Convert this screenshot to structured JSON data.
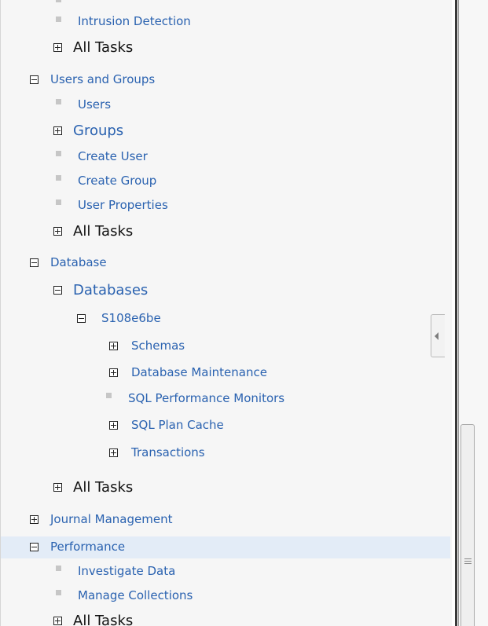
{
  "nav": {
    "intrusion_detection": "Intrusion Detection",
    "all_tasks_1": "All Tasks",
    "users_and_groups": "Users and Groups",
    "users": "Users",
    "groups": "Groups",
    "create_user": "Create User",
    "create_group": "Create Group",
    "user_properties": "User Properties",
    "all_tasks_2": "All Tasks",
    "database": "Database",
    "databases": "Databases",
    "db_name": "S108e6be",
    "schemas": "Schemas",
    "database_maintenance": "Database Maintenance",
    "sql_performance_monitors": "SQL Performance Monitors",
    "sql_plan_cache": "SQL Plan Cache",
    "transactions": "Transactions",
    "all_tasks_3": "All Tasks",
    "journal_management": "Journal Management",
    "performance": "Performance",
    "investigate_data": "Investigate Data",
    "manage_collections": "Manage Collections",
    "all_tasks_4": "All Tasks"
  },
  "colors": {
    "link": "#2a62b0",
    "selected_row": "#e3ecf7",
    "panel_bg": "#f6f6f6"
  }
}
